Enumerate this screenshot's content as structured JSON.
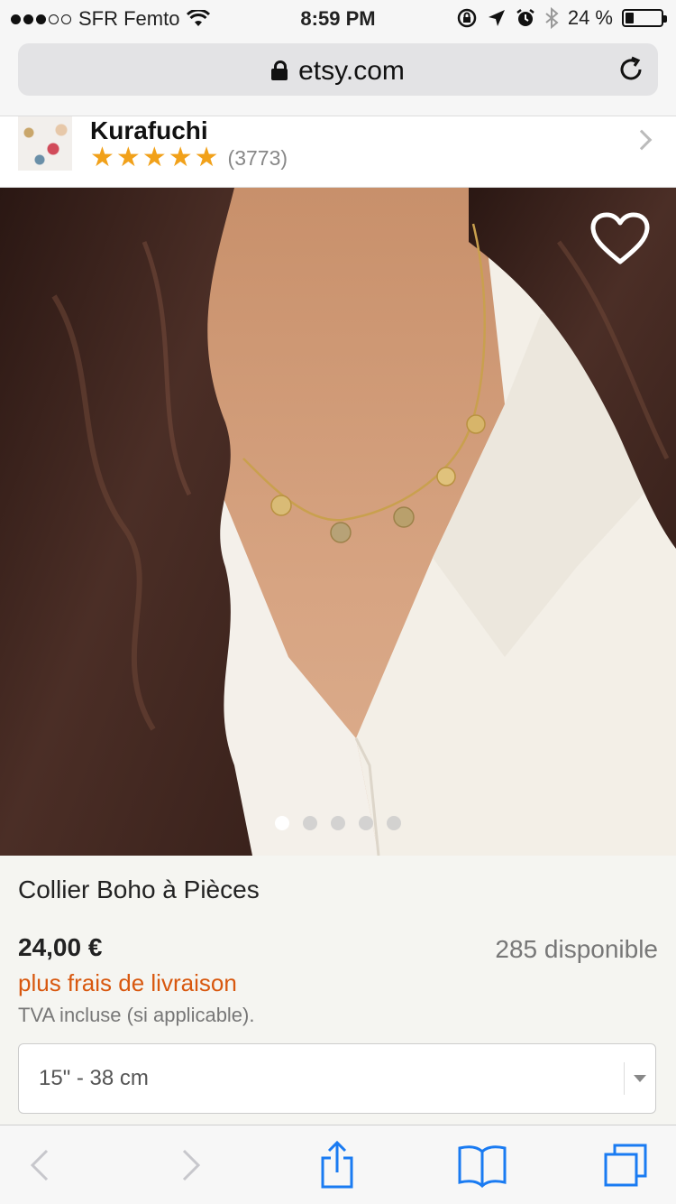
{
  "status_bar": {
    "carrier": "SFR Femto",
    "time": "8:59 PM",
    "battery": "24 %",
    "battery_level": 0.24,
    "signal_bars_filled": 3,
    "signal_bars_total": 5
  },
  "browser": {
    "url": "etsy.com"
  },
  "shop": {
    "name": "Kurafuchi",
    "rating_stars": 5,
    "reviews": "(3773)"
  },
  "gallery": {
    "image_count": 5,
    "active_index": 0
  },
  "product": {
    "title": "Collier Boho à Pièces",
    "price": "24,00 €",
    "stock": "285 disponible",
    "shipping": "plus frais de livraison",
    "vat": "TVA incluse (si applicable).",
    "variation_selected": "15\" - 38 cm"
  },
  "colors": {
    "accent_orange": "#d8580f",
    "star": "#f1a11a"
  },
  "icons": {
    "favorite": "heart-icon",
    "back": "chevron-left-icon",
    "forward": "chevron-right-icon",
    "share": "share-icon",
    "bookmarks": "book-icon",
    "tabs": "tabs-icon"
  }
}
